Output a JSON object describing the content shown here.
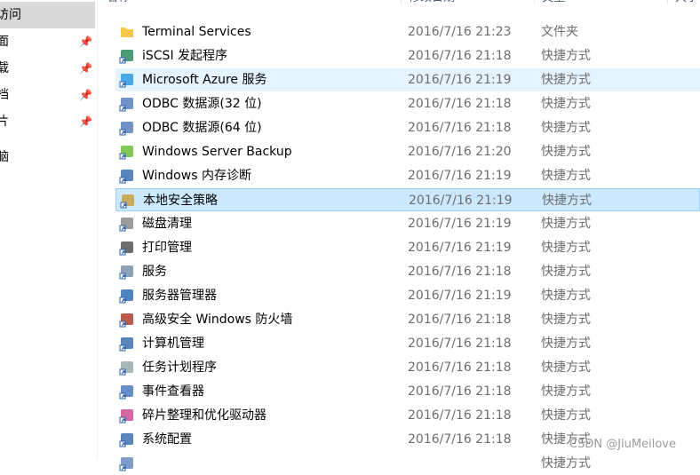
{
  "sidebar": {
    "items": [
      {
        "label": "访问",
        "selected": true,
        "pinned": false
      },
      {
        "label": "面",
        "pinned": true
      },
      {
        "label": "载",
        "pinned": true
      },
      {
        "label": "档",
        "pinned": true
      },
      {
        "label": "片",
        "pinned": true
      },
      {
        "label": "脑",
        "pinned": false
      }
    ]
  },
  "header": {
    "name": "名称",
    "date": "修改日期",
    "type": "类型",
    "size": "大小"
  },
  "files": [
    {
      "name": "Terminal Services",
      "date": "2016/7/16 21:23",
      "type": "文件夹",
      "icon": "folder-icon"
    },
    {
      "name": "iSCSI 发起程序",
      "date": "2016/7/16 21:18",
      "type": "快捷方式",
      "icon": "globe-shield-icon"
    },
    {
      "name": "Microsoft Azure 服务",
      "date": "2016/7/16 21:19",
      "type": "快捷方式",
      "icon": "cloud-icon",
      "state": "hover"
    },
    {
      "name": "ODBC 数据源(32 位)",
      "date": "2016/7/16 21:18",
      "type": "快捷方式",
      "icon": "database-icon"
    },
    {
      "name": "ODBC 数据源(64 位)",
      "date": "2016/7/16 21:18",
      "type": "快捷方式",
      "icon": "database-icon"
    },
    {
      "name": "Windows Server Backup",
      "date": "2016/7/16 21:20",
      "type": "快捷方式",
      "icon": "backup-icon"
    },
    {
      "name": "Windows 内存诊断",
      "date": "2016/7/16 21:19",
      "type": "快捷方式",
      "icon": "memory-icon"
    },
    {
      "name": "本地安全策略",
      "date": "2016/7/16 21:19",
      "type": "快捷方式",
      "icon": "security-policy-icon",
      "state": "selected"
    },
    {
      "name": "磁盘清理",
      "date": "2016/7/16 21:19",
      "type": "快捷方式",
      "icon": "disk-cleanup-icon"
    },
    {
      "name": "打印管理",
      "date": "2016/7/16 21:19",
      "type": "快捷方式",
      "icon": "printer-icon"
    },
    {
      "name": "服务",
      "date": "2016/7/16 21:18",
      "type": "快捷方式",
      "icon": "gears-icon"
    },
    {
      "name": "服务器管理器",
      "date": "2016/7/16 21:19",
      "type": "快捷方式",
      "icon": "server-manager-icon"
    },
    {
      "name": "高级安全 Windows 防火墙",
      "date": "2016/7/16 21:18",
      "type": "快捷方式",
      "icon": "firewall-icon"
    },
    {
      "name": "计算机管理",
      "date": "2016/7/16 21:18",
      "type": "快捷方式",
      "icon": "computer-management-icon"
    },
    {
      "name": "任务计划程序",
      "date": "2016/7/16 21:18",
      "type": "快捷方式",
      "icon": "clock-icon"
    },
    {
      "name": "事件查看器",
      "date": "2016/7/16 21:18",
      "type": "快捷方式",
      "icon": "event-viewer-icon"
    },
    {
      "name": "碎片整理和优化驱动器",
      "date": "2016/7/16 21:18",
      "type": "快捷方式",
      "icon": "defrag-icon"
    },
    {
      "name": "系统配置",
      "date": "2016/7/16 21:18",
      "type": "快捷方式",
      "icon": "system-config-icon"
    },
    {
      "name": "",
      "date": "",
      "type": "快捷方式",
      "icon": "shortcut-icon"
    }
  ],
  "watermark": "CSDN @JiuMeilove",
  "colors": {
    "hover": "#e5f3ff",
    "selected": "#cce8ff",
    "selected_border": "#99d1ff"
  }
}
